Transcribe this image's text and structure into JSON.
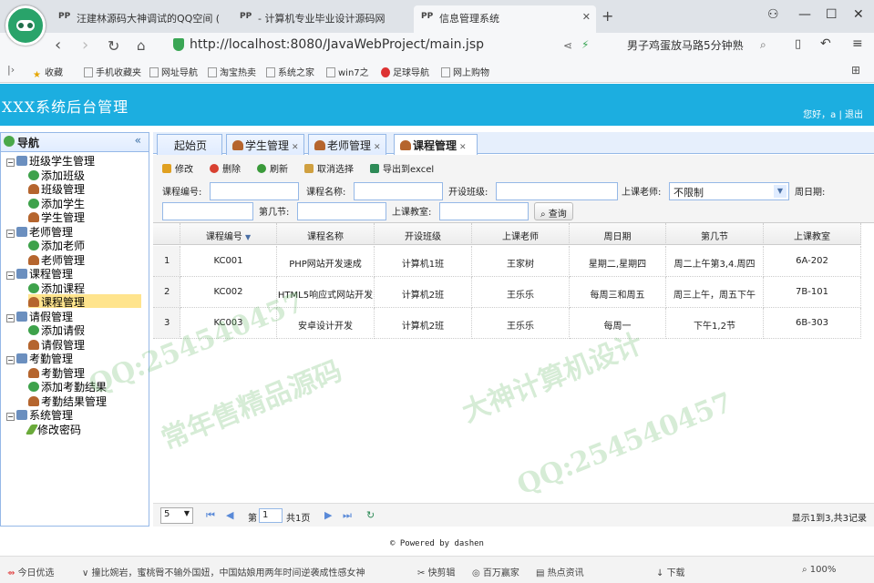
{
  "browser": {
    "tabs": [
      {
        "label": "汪建林源码大神调试的QQ空间 (",
        "fav": "PP"
      },
      {
        "label": "- 计算机专业毕业设计源码网",
        "fav": "PP"
      },
      {
        "label": "信息管理系统",
        "fav": "PP"
      }
    ],
    "new_tab": "+",
    "url": "http://localhost:8080/JavaWebProject/main.jsp",
    "search_text": "男子鸡蛋放马路5分钟熟",
    "bookmarks": [
      "收藏",
      "手机收藏夹",
      "网址导航",
      "淘宝热卖",
      "系统之家",
      "win7之",
      "足球导航",
      "网上购物"
    ]
  },
  "app": {
    "title": "XXX系统后台管理",
    "user_greeting": "您好，a",
    "logout": "退出"
  },
  "sidebar": {
    "title": "导航",
    "collapse": "«",
    "groups": [
      {
        "label": "班级学生管理",
        "items": [
          {
            "label": "添加班级",
            "icon": "add"
          },
          {
            "label": "班级管理",
            "icon": "user"
          },
          {
            "label": "添加学生",
            "icon": "add"
          },
          {
            "label": "学生管理",
            "icon": "user"
          }
        ]
      },
      {
        "label": "老师管理",
        "items": [
          {
            "label": "添加老师",
            "icon": "add"
          },
          {
            "label": "老师管理",
            "icon": "user"
          }
        ]
      },
      {
        "label": "课程管理",
        "items": [
          {
            "label": "添加课程",
            "icon": "add"
          },
          {
            "label": "课程管理",
            "icon": "user"
          }
        ]
      },
      {
        "label": "请假管理",
        "items": [
          {
            "label": "添加请假",
            "icon": "add"
          },
          {
            "label": "请假管理",
            "icon": "user"
          }
        ]
      },
      {
        "label": "考勤管理",
        "items": [
          {
            "label": "考勤管理",
            "icon": "user"
          },
          {
            "label": "添加考勤结果",
            "icon": "add"
          },
          {
            "label": "考勤结果管理",
            "icon": "user"
          }
        ]
      },
      {
        "label": "系统管理",
        "items": [
          {
            "label": "修改密码",
            "icon": "pen"
          }
        ]
      }
    ]
  },
  "content_tabs": [
    "起始页",
    "学生管理",
    "老师管理",
    "课程管理"
  ],
  "toolbar": [
    "修改",
    "删除",
    "刷新",
    "取消选择",
    "导出到excel"
  ],
  "search_form": {
    "course_no": "课程编号:",
    "course_name": "课程名称:",
    "class": "开设班级:",
    "teacher": "上课老师:",
    "teacher_value": "不限制",
    "weekday": "周日期:",
    "period": "第几节:",
    "room": "上课教室:",
    "query": "查询"
  },
  "grid": {
    "columns": [
      "课程编号",
      "课程名称",
      "开设班级",
      "上课老师",
      "周日期",
      "第几节",
      "上课教室"
    ],
    "sort_mark": "▼",
    "rows": [
      [
        "1",
        "KC001",
        "PHP网站开发速成",
        "计算机1班",
        "王家树",
        "星期二,星期四",
        "周二上午第3,4.周四",
        "6A-202"
      ],
      [
        "2",
        "KC002",
        "HTML5响应式网站开发",
        "计算机2班",
        "王乐乐",
        "每周三和周五",
        "周三上午，周五下午",
        "7B-101"
      ],
      [
        "3",
        "KC003",
        "安卓设计开发",
        "计算机2班",
        "王乐乐",
        "每周一",
        "下午1,2节",
        "6B-303"
      ]
    ]
  },
  "pager": {
    "page_size": "5",
    "page_label": "第",
    "page_value": "1",
    "total_pages": "共1页",
    "summary": "显示1到3,共3记录"
  },
  "footer": "© Powered by dashen",
  "statusbar": [
    "今日优选",
    "撞比婉岩，蜜桃臀不输外国妞，中国姑娘用两年时间逆袭成性感女神",
    "快剪辑",
    "百万赢家",
    "热点资讯",
    "下载",
    "100%"
  ],
  "watermarks": [
    "QQ:254540457",
    "常年售精品源码",
    "大神计算机设计"
  ]
}
